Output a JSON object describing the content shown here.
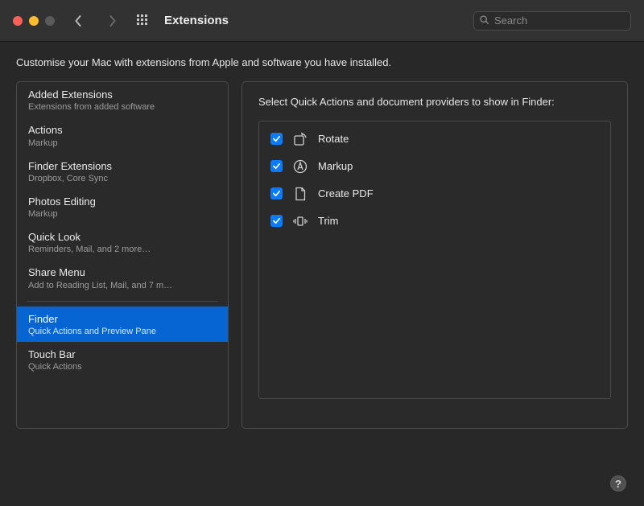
{
  "window": {
    "title": "Extensions",
    "search_placeholder": "Search"
  },
  "intro": "Customise your Mac with extensions from Apple and software you have installed.",
  "sidebar": {
    "items": [
      {
        "title": "Added Extensions",
        "subtitle": "Extensions from added software"
      },
      {
        "title": "Actions",
        "subtitle": "Markup"
      },
      {
        "title": "Finder Extensions",
        "subtitle": "Dropbox, Core Sync"
      },
      {
        "title": "Photos Editing",
        "subtitle": "Markup"
      },
      {
        "title": "Quick Look",
        "subtitle": "Reminders, Mail, and 2 more…"
      },
      {
        "title": "Share Menu",
        "subtitle": "Add to Reading List, Mail, and 7 m…"
      },
      {
        "title": "Finder",
        "subtitle": "Quick Actions and Preview Pane"
      },
      {
        "title": "Touch Bar",
        "subtitle": "Quick Actions"
      }
    ],
    "selected_index": 6
  },
  "main": {
    "heading": "Select Quick Actions and document providers to show in Finder:",
    "quick_actions": [
      {
        "label": "Rotate",
        "checked": true,
        "icon": "rotate"
      },
      {
        "label": "Markup",
        "checked": true,
        "icon": "markup"
      },
      {
        "label": "Create PDF",
        "checked": true,
        "icon": "create-pdf"
      },
      {
        "label": "Trim",
        "checked": true,
        "icon": "trim"
      }
    ]
  },
  "help_label": "?"
}
